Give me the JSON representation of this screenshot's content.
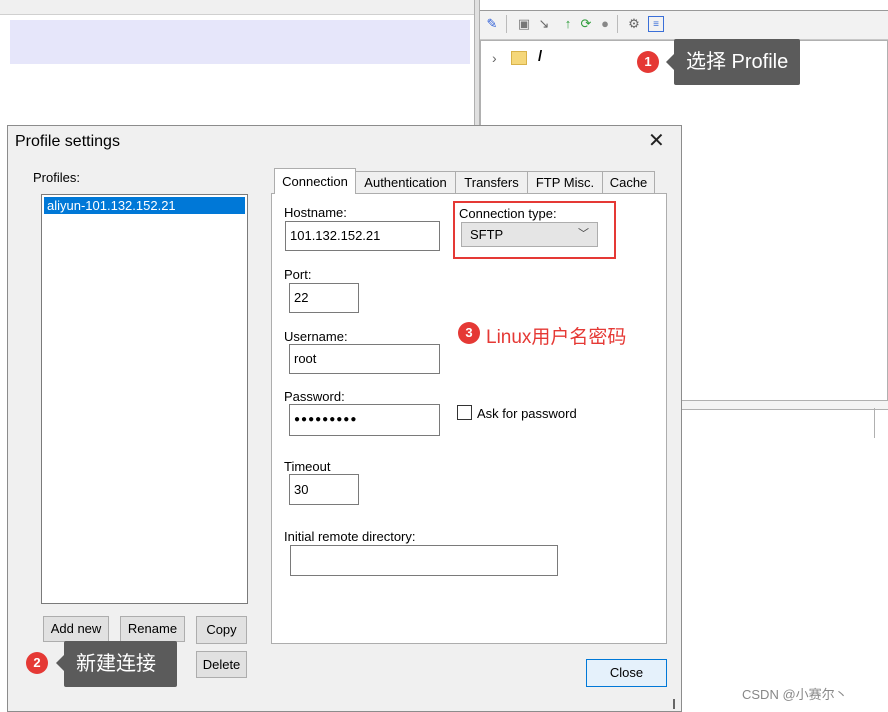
{
  "colors": {
    "accent": "#0078d7",
    "annotation_red": "#e53935",
    "callout_bg": "#5b5b5b",
    "dialog_bg": "#f0f0f0"
  },
  "background": {
    "tree_root": "/"
  },
  "toolbar_icons": [
    "connect-icon",
    "disconnect-icon",
    "download-icon",
    "upload-icon",
    "refresh-icon",
    "stop-icon",
    "settings-icon",
    "view-icon"
  ],
  "annotations": [
    {
      "number": "1",
      "text": "选择 Profile"
    },
    {
      "number": "2",
      "text": "新建连接"
    },
    {
      "number": "3",
      "text": "Linux用户名密码"
    }
  ],
  "dialog": {
    "title": "Profile settings",
    "close_glyph": "✕",
    "profiles_label": "Profiles:",
    "profiles": [
      "aliyun-101.132.152.21"
    ],
    "buttons": {
      "add_new": "Add new",
      "rename": "Rename",
      "copy": "Copy",
      "delete": "Delete",
      "close": "Close"
    },
    "tabs": [
      "Connection",
      "Authentication",
      "Transfers",
      "FTP Misc.",
      "Cache"
    ],
    "active_tab": "Connection",
    "connection": {
      "hostname_label": "Hostname:",
      "hostname": "101.132.152.21",
      "connection_type_label": "Connection type:",
      "connection_type": "SFTP",
      "port_label": "Port:",
      "port": "22",
      "username_label": "Username:",
      "username": "root",
      "password_label": "Password:",
      "password_masked": "●●●●●●●●●",
      "ask_for_password_label": "Ask for password",
      "ask_for_password_checked": false,
      "timeout_label": "Timeout",
      "timeout": "30",
      "initial_dir_label": "Initial remote directory:",
      "initial_dir": ""
    }
  },
  "watermark": "CSDN @小赛尔丶"
}
